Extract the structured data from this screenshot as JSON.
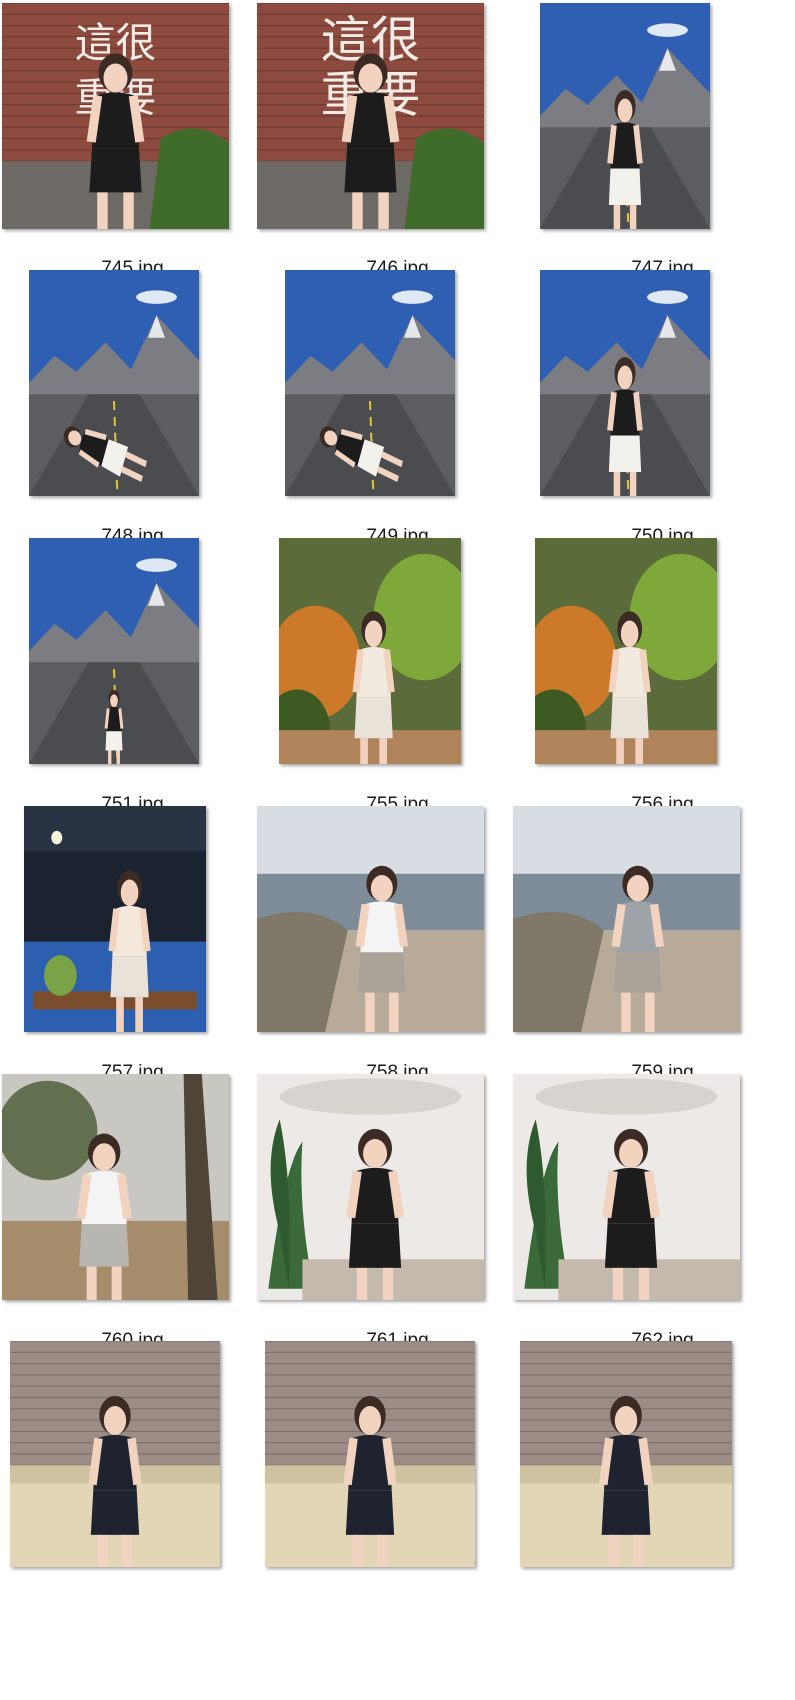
{
  "gallery": {
    "items": [
      {
        "name": "745.jpg",
        "scene": "brick-sign"
      },
      {
        "name": "746.jpg",
        "scene": "brick-sign"
      },
      {
        "name": "747.jpg",
        "scene": "mountain-road"
      },
      {
        "name": "748.jpg",
        "scene": "mountain-road"
      },
      {
        "name": "749.jpg",
        "scene": "mountain-road"
      },
      {
        "name": "750.jpg",
        "scene": "mountain-road"
      },
      {
        "name": "751.jpg",
        "scene": "mountain-road"
      },
      {
        "name": "755.jpg",
        "scene": "garden"
      },
      {
        "name": "756.jpg",
        "scene": "garden"
      },
      {
        "name": "757.jpg",
        "scene": "night-cafe"
      },
      {
        "name": "758.jpg",
        "scene": "seashore"
      },
      {
        "name": "759.jpg",
        "scene": "seashore"
      },
      {
        "name": "760.jpg",
        "scene": "beach-trees"
      },
      {
        "name": "761.jpg",
        "scene": "studio-plant"
      },
      {
        "name": "762.jpg",
        "scene": "studio-plant"
      },
      {
        "name": "",
        "scene": "brick-sofa"
      },
      {
        "name": "",
        "scene": "brick-sofa"
      },
      {
        "name": "",
        "scene": "brick-sofa"
      }
    ],
    "sign_text": "這很重要"
  }
}
